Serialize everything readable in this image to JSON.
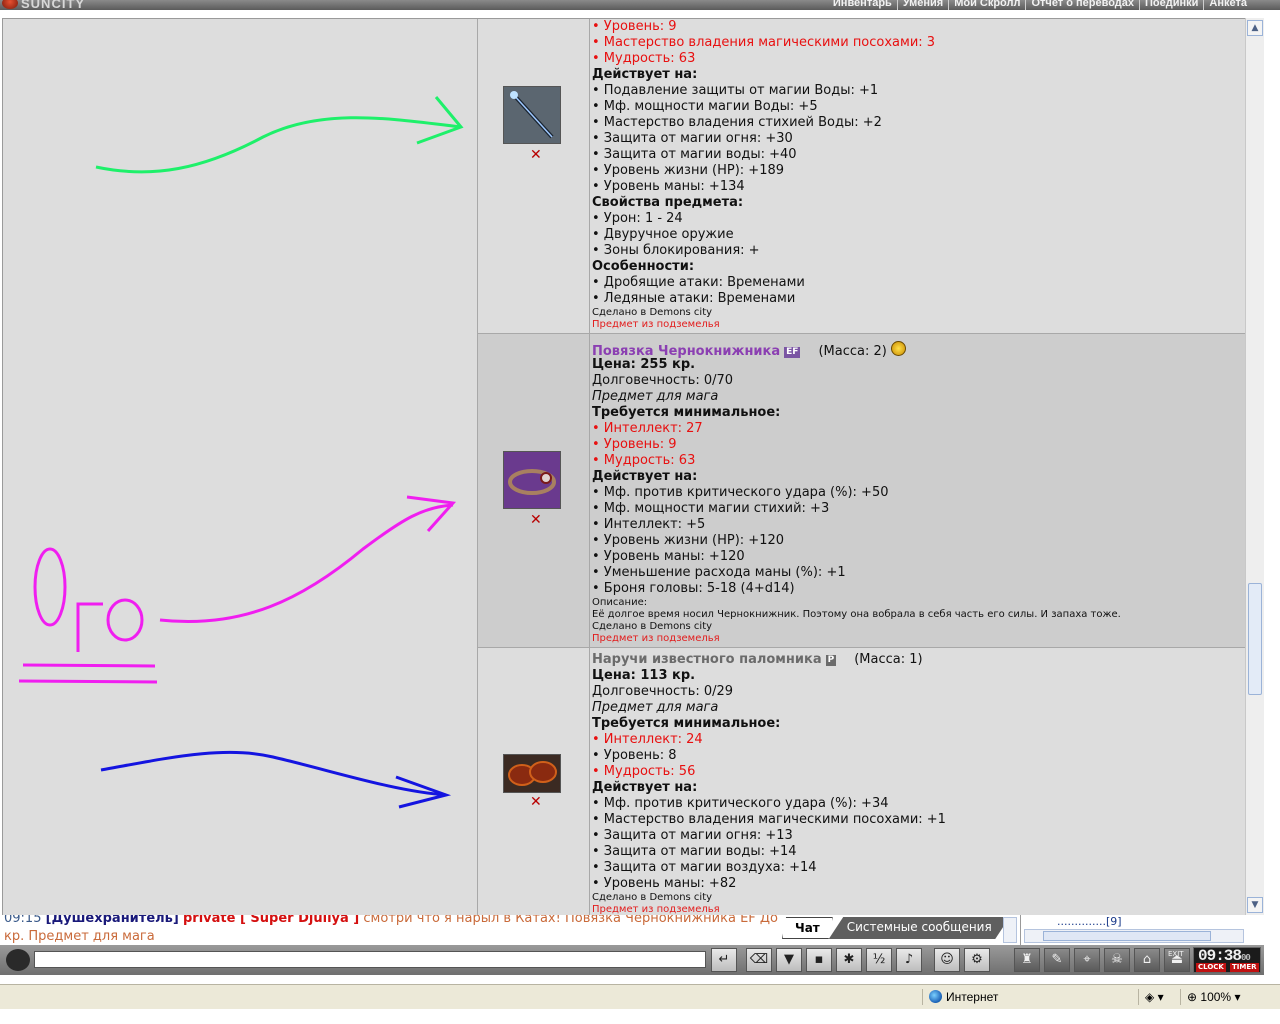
{
  "app": {
    "logo_text": "SUNCITY"
  },
  "nav": [
    "Инвентарь",
    "Умения",
    "Мои Скролл",
    "Отчет о переводах",
    "Поединки",
    "Анкета"
  ],
  "items": [
    {
      "lines": [
        {
          "t": "• Уровень: 9",
          "c": "red"
        },
        {
          "t": "• Мастерство владения магическими посохами: 3",
          "c": "red"
        },
        {
          "t": "• Мудрость: 63",
          "c": "red"
        },
        {
          "t": "Действует на:",
          "c": "b"
        },
        {
          "t": "• Подавление защиты от магии Воды: +1"
        },
        {
          "t": "• Мф. мощности магии Воды: +5"
        },
        {
          "t": "• Мастерство владения стихией Воды: +2"
        },
        {
          "t": "• Защита от магии огня: +30"
        },
        {
          "t": "• Защита от магии воды: +40"
        },
        {
          "t": "• Уровень жизни (HP): +189"
        },
        {
          "t": "• Уровень маны: +134"
        },
        {
          "t": "Свойства предмета:",
          "c": "b"
        },
        {
          "t": "• Урон: 1 - 24"
        },
        {
          "t": "• Двуручное оружие"
        },
        {
          "t": "• Зоны блокирования: +"
        },
        {
          "t": "Особенности:",
          "c": "b"
        },
        {
          "t": "• Дробящие атаки: Временами"
        },
        {
          "t": "• Ледяные атаки: Временами"
        }
      ],
      "made_in": "Сделано в Demons city",
      "dungeon": "Предмет из подземелья"
    },
    {
      "name": "Повязка Чернокнижника",
      "badge": "EF",
      "mass": "(Масса: 2)",
      "price": "Цена: 255 кр.",
      "durability": "Долговечность: 0/70",
      "for_class": "Предмет для мага",
      "lines": [
        {
          "t": "Требуется минимальное:",
          "c": "b"
        },
        {
          "t": "• Интеллект: 27",
          "c": "red"
        },
        {
          "t": "• Уровень: 9",
          "c": "red"
        },
        {
          "t": "• Мудрость: 63",
          "c": "red"
        },
        {
          "t": "Действует на:",
          "c": "b"
        },
        {
          "t": "• Мф. против критического удара (%): +50"
        },
        {
          "t": "• Мф. мощности магии стихий: +3"
        },
        {
          "t": "• Интеллект: +5"
        },
        {
          "t": "• Уровень жизни (HP): +120"
        },
        {
          "t": "• Уровень маны: +120"
        },
        {
          "t": "• Уменьшение расхода маны (%): +1"
        },
        {
          "t": "• Броня головы: 5-18 (4+d14)"
        }
      ],
      "description_label": "Описание:",
      "description": "Её долгое время носил Чернокнижник. Поэтому она вобрала в себя часть его силы. И запаха тоже.",
      "made_in": "Сделано в Demons city",
      "dungeon": "Предмет из подземелья"
    },
    {
      "name": "Наручи известного паломника",
      "badge": "P",
      "mass": "(Масса: 1)",
      "price": "Цена: 113 кр.",
      "durability": "Долговечность: 0/29",
      "for_class": "Предмет для мага",
      "lines": [
        {
          "t": "Требуется минимальное:",
          "c": "b"
        },
        {
          "t": "• Интеллект: 24",
          "c": "red"
        },
        {
          "t": "• Уровень: 8"
        },
        {
          "t": "• Мудрость: 56",
          "c": "red"
        },
        {
          "t": "Действует на:",
          "c": "b"
        },
        {
          "t": "• Мф. против критического удара (%): +34"
        },
        {
          "t": "• Мастерство владения магическими посохами: +1"
        },
        {
          "t": "• Защита от магии огня: +13"
        },
        {
          "t": "• Защита от магии воды: +14"
        },
        {
          "t": "• Защита от магии воздуха: +14"
        },
        {
          "t": "• Уровень маны: +82"
        }
      ],
      "made_in": "Сделано в Demons city",
      "dungeon": "Предмет из подземелья"
    }
  ],
  "delete_glyph": "✕",
  "annotation": {
    "handwritten_text": "Ого"
  },
  "colors": {
    "green_arrow": "#1ef06a",
    "magenta_arrow": "#f01ef0",
    "blue_arrow": "#1414e0",
    "red_text": "#e81010"
  },
  "chat": {
    "time": "09:15",
    "nick": "Душехранитель",
    "private_label": "private [ Super Djuliya ]",
    "message_part1": "смотри что я нарыл в Катах! Повязка Чернокнижника EF До",
    "message_part2": "кр. Предмет для мага",
    "tabs": [
      "Чат",
      "Системные сообщения"
    ],
    "users_snippet": "..............[9]"
  },
  "clock": {
    "time": "09:38",
    "seconds": "00",
    "label_clock": "CLOCK",
    "label_timer": "TIMER",
    "exit_label": "EXIT"
  },
  "statusbar": {
    "zone": "Интернет",
    "zoom": "100%"
  }
}
